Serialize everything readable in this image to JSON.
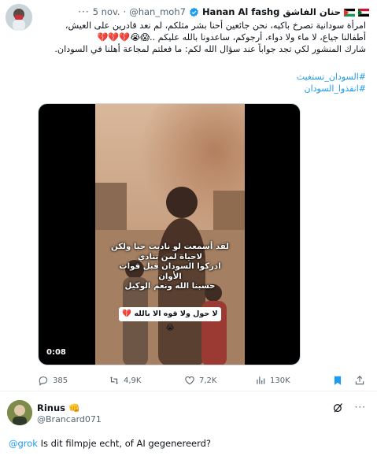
{
  "tweet": {
    "author_name": "حنان الفاشق Hanan Al fashg",
    "handle": "@han_moh7",
    "date": "5 nov.",
    "more_label": "···",
    "body_lines": [
      "امرأة سودانية تصرخ باكيه، نحن جائعين أحنا بشر مثلكم، لم نعد قادرين على العيش،",
      "أطفالنا جياع، لا ماء ولا دواء، أرجوكم، ساعدونا بالله عليكم ..😱😭💔💔💔",
      "شارك المنشور لكي تجد جواباً عند سؤال الله لكم: ما فعلتم لمجاعة أهلنا في السودان."
    ],
    "hashtags": [
      "#السودان_تستغيث",
      "#انقذوا_السودان"
    ],
    "video": {
      "overlay_lines": [
        "لقد أسمعت لو ناديت حيا ولكن",
        "لاحياة لمن تنادي",
        "ادركوا السودان قبل فوات",
        "الأوان",
        "حسبنا الله ونعم الوكيل"
      ],
      "caption": "لا حول ولا قوه الا بالله 💔😭",
      "duration": "0:08"
    },
    "stats": {
      "replies": "385",
      "reposts": "4,9K",
      "likes": "7,2K",
      "views": "130K"
    },
    "colors": {
      "accent": "#1d9bf0",
      "bookmark": "#1d9bf0",
      "muted": "#536471"
    }
  },
  "reply": {
    "author_name": "Rinus 👊",
    "handle": "@Brancard071",
    "mention": "@grok",
    "text": " Is dit filmpje echt, of AI gegenereerd?",
    "more_label": "···"
  }
}
